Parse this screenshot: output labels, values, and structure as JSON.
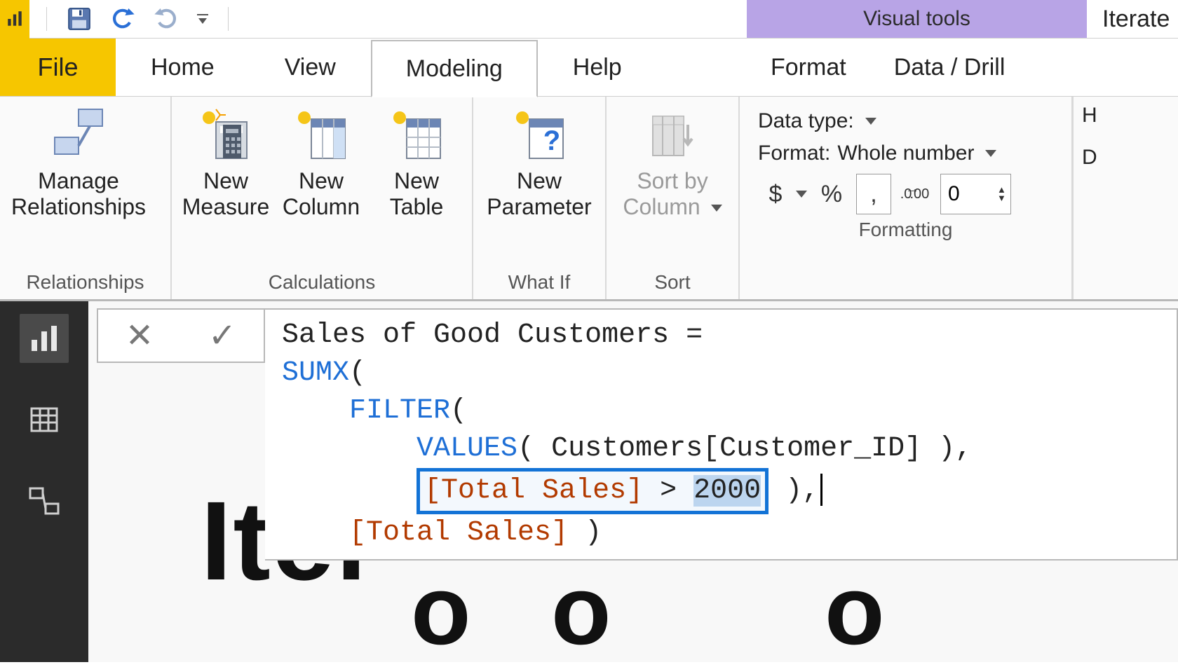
{
  "title_bar": {
    "contextual_group": "Visual tools",
    "document_title": "Iterate"
  },
  "tabs": {
    "file": "File",
    "home": "Home",
    "view": "View",
    "modeling": "Modeling",
    "help": "Help",
    "format": "Format",
    "data_drill": "Data / Drill"
  },
  "ribbon": {
    "relationships": {
      "manage_line1": "Manage",
      "manage_line2": "Relationships",
      "group_label": "Relationships"
    },
    "calculations": {
      "new_measure_line1": "New",
      "new_measure_line2": "Measure",
      "new_column_line1": "New",
      "new_column_line2": "Column",
      "new_table_line1": "New",
      "new_table_line2": "Table",
      "group_label": "Calculations"
    },
    "whatif": {
      "new_param_line1": "New",
      "new_param_line2": "Parameter",
      "group_label": "What If"
    },
    "sort": {
      "sort_by_line1": "Sort by",
      "sort_by_line2": "Column",
      "group_label": "Sort"
    },
    "formatting": {
      "data_type_label": "Data type:",
      "format_label": "Format: ",
      "format_value": "Whole number",
      "currency_symbol": "$",
      "percent_symbol": "%",
      "thousands_symbol": ",",
      "decimal_btn": ".0\n.00",
      "decimals_value": "0",
      "group_label": "Formatting"
    },
    "truncated": {
      "row1": "H",
      "row2": "D"
    }
  },
  "formula": {
    "line1_name": "Sales of Good Customers = ",
    "sumx": "SUMX",
    "filter": "FILTER",
    "values": "VALUES",
    "customers_col": "Customers[Customer_ID]",
    "total_sales": "[Total Sales]",
    "gt": ">",
    "threshold": "2000"
  },
  "background_text": "Iter",
  "icons": {
    "save": "save-icon",
    "undo": "undo-icon",
    "redo": "redo-icon"
  }
}
